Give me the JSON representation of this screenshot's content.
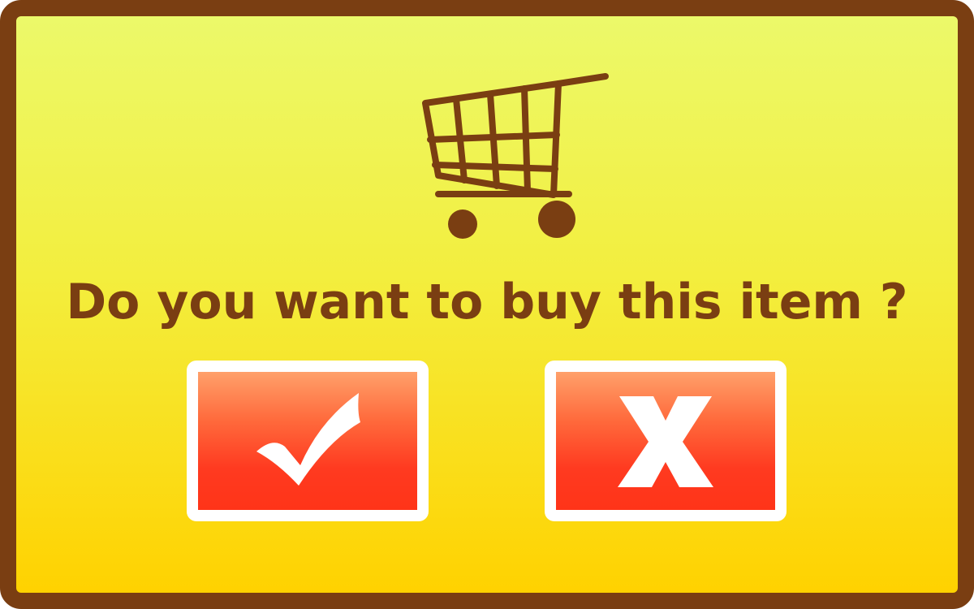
{
  "dialog": {
    "question": "Do you want to buy this item ?",
    "icon": "shopping-cart-icon",
    "confirm_icon": "checkmark-icon",
    "cancel_icon": "x-icon"
  },
  "colors": {
    "frame": "#7a3e12",
    "background_top": "#ecf96a",
    "background_bottom": "#ffd200",
    "button_top": "#ffa06a",
    "button_bottom": "#ff3418",
    "button_border": "#ffffff"
  }
}
